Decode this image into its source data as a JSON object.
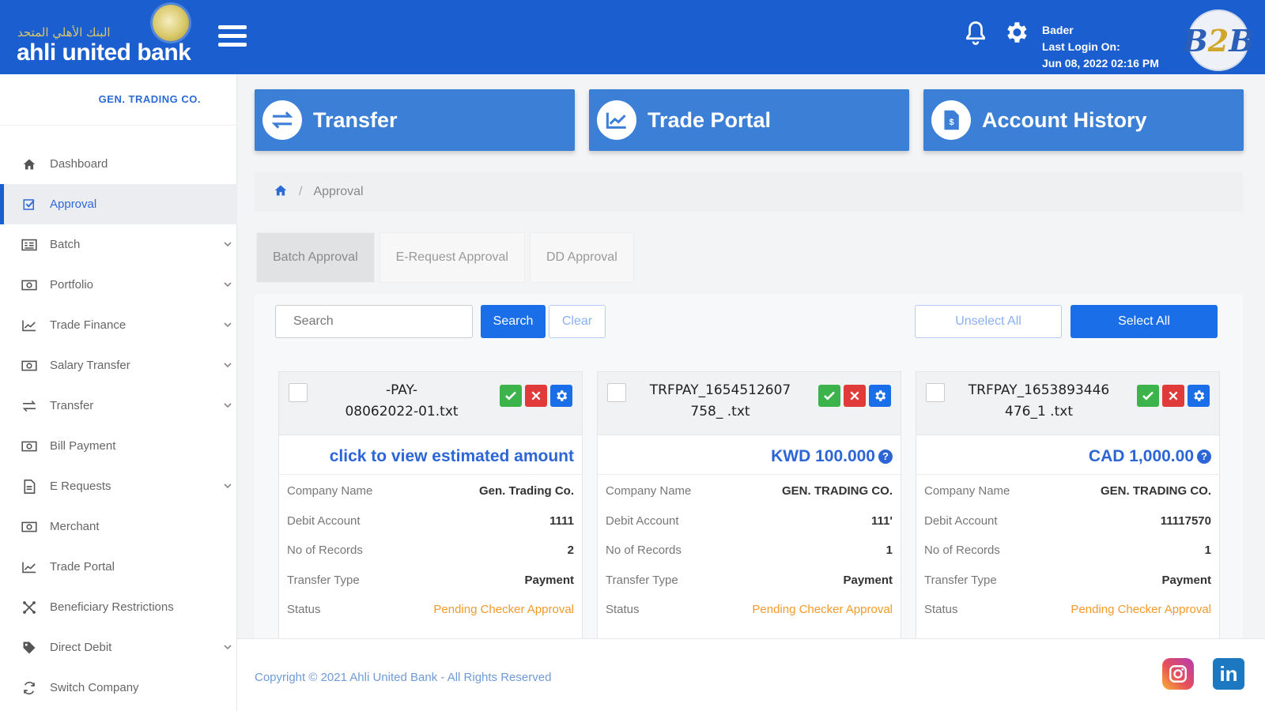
{
  "brand": {
    "arabic_name": "البنك الأهلي المتحد",
    "name": "ahli united bank"
  },
  "header": {
    "user_name": "Bader",
    "last_login_label": "Last Login On:",
    "last_login_time": "Jun 08, 2022 02:16 PM",
    "b2b_logo": {
      "b": "B",
      "two": "2",
      "b2": "B"
    },
    "icons": [
      "bell-icon",
      "gear-icon",
      "hamburger-menu-icon"
    ]
  },
  "sidebar": {
    "company": "GEN. TRADING CO.",
    "items": [
      {
        "label": "Dashboard",
        "icon": "home-icon",
        "active": false,
        "expandable": false
      },
      {
        "label": "Approval",
        "icon": "checkbox-icon",
        "active": true,
        "expandable": false
      },
      {
        "label": "Batch",
        "icon": "batch-icon",
        "active": false,
        "expandable": true
      },
      {
        "label": "Portfolio",
        "icon": "portfolio-icon",
        "active": false,
        "expandable": true
      },
      {
        "label": "Trade Finance",
        "icon": "chart-line-icon",
        "active": false,
        "expandable": true
      },
      {
        "label": "Salary Transfer",
        "icon": "money-icon",
        "active": false,
        "expandable": true
      },
      {
        "label": "Transfer",
        "icon": "exchange-icon",
        "active": false,
        "expandable": true
      },
      {
        "label": "Bill Payment",
        "icon": "money-icon",
        "active": false,
        "expandable": false
      },
      {
        "label": "E Requests",
        "icon": "document-icon",
        "active": false,
        "expandable": true
      },
      {
        "label": "Merchant",
        "icon": "money-icon",
        "active": false,
        "expandable": false
      },
      {
        "label": "Trade Portal",
        "icon": "chart-line-icon",
        "active": false,
        "expandable": false
      },
      {
        "label": "Beneficiary Restrictions",
        "icon": "restrict-icon",
        "active": false,
        "expandable": false
      },
      {
        "label": "Direct Debit",
        "icon": "tag-icon",
        "active": false,
        "expandable": true
      },
      {
        "label": "Switch Company",
        "icon": "refresh-icon",
        "active": false,
        "expandable": false
      }
    ]
  },
  "tiles": [
    {
      "label": "Transfer",
      "icon": "exchange-icon"
    },
    {
      "label": "Trade Portal",
      "icon": "chart-line-icon"
    },
    {
      "label": "Account History",
      "icon": "document-icon"
    }
  ],
  "breadcrumb": {
    "current": "Approval"
  },
  "tabs": [
    {
      "label": "Batch Approval",
      "active": true
    },
    {
      "label": "E-Request Approval",
      "active": false
    },
    {
      "label": "DD Approval",
      "active": false
    }
  ],
  "toolbar": {
    "search_placeholder": "Search",
    "search_label": "Search",
    "clear_label": "Clear",
    "unselect_all_label": "Unselect All",
    "select_all_label": "Select All"
  },
  "labels": {
    "company_name": "Company Name",
    "debit_account": "Debit Account",
    "no_of_records": "No of Records",
    "transfer_type": "Transfer Type",
    "status": "Status"
  },
  "cards": [
    {
      "file_line1": "-PAY-",
      "file_line2": "08062022-01.txt",
      "amount": "click to view estimated amount",
      "amount_help": false,
      "company_name": "Gen. Trading Co.",
      "debit_account": "1111",
      "no_of_records": "2",
      "transfer_type": "Payment",
      "status": "Pending Checker Approval"
    },
    {
      "file_line1": "TRFPAY_1654512607",
      "file_line2": "758_              .txt",
      "amount": "KWD 100.000",
      "amount_help": true,
      "company_name": "GEN. TRADING CO.",
      "debit_account": "111'",
      "no_of_records": "1",
      "transfer_type": "Payment",
      "status": "Pending Checker Approval"
    },
    {
      "file_line1": "TRFPAY_1653893446",
      "file_line2": "476_1              .txt",
      "amount": "CAD 1,000.00",
      "amount_help": true,
      "company_name": "GEN. TRADING CO.",
      "debit_account": "11117570",
      "no_of_records": "1",
      "transfer_type": "Payment",
      "status": "Pending Checker Approval"
    }
  ],
  "footer": {
    "copyright": "Copyright © 2021 Ahli United Bank - All Rights Reserved",
    "social": [
      "instagram-icon",
      "linkedin-icon"
    ]
  },
  "colors": {
    "primary": "#1a5ecf",
    "tile": "#3b7fd6",
    "button": "#1a6fe8",
    "status_pending": "#f39a2a",
    "approve": "#3cb44b",
    "reject": "#e03a3a"
  }
}
